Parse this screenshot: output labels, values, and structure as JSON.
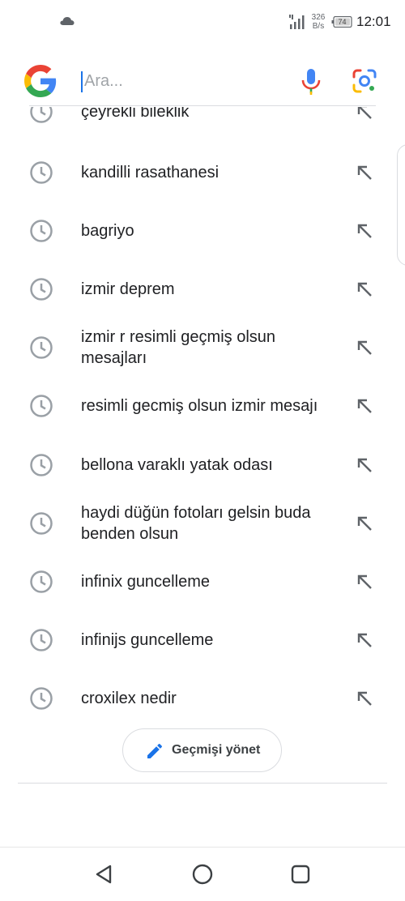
{
  "status_bar": {
    "time": "12:01",
    "net_speed_value": "326",
    "net_speed_unit": "B/s",
    "battery": "74",
    "icons": [
      "cloud-icon",
      "signal-icon",
      "battery-icon"
    ]
  },
  "search": {
    "placeholder": "Ara...",
    "value": "",
    "icons": [
      "google-logo",
      "mic-icon",
      "lens-icon"
    ]
  },
  "history": [
    {
      "text": "çeyrekli bileklik"
    },
    {
      "text": "kandilli rasathanesi"
    },
    {
      "text": "bagriyo"
    },
    {
      "text": "izmir deprem"
    },
    {
      "text": "izmir r resimli geçmiş olsun mesajları"
    },
    {
      "text": "resimli gecmiş olsun izmir mesajı"
    },
    {
      "text": "bellona varaklı yatak odası"
    },
    {
      "text": "haydi düğün fotoları gelsin buda benden olsun"
    },
    {
      "text": "infinix guncelleme"
    },
    {
      "text": "infinijs guncelleme"
    },
    {
      "text": "croxilex nedir"
    }
  ],
  "manage_history": {
    "label": "Geçmişi yönet"
  },
  "colors": {
    "accent": "#1a73e8",
    "icon_gray": "#9aa0a6",
    "text": "#202124"
  },
  "nav": {
    "icons": [
      "back-icon",
      "home-icon",
      "recent-apps-icon"
    ]
  }
}
